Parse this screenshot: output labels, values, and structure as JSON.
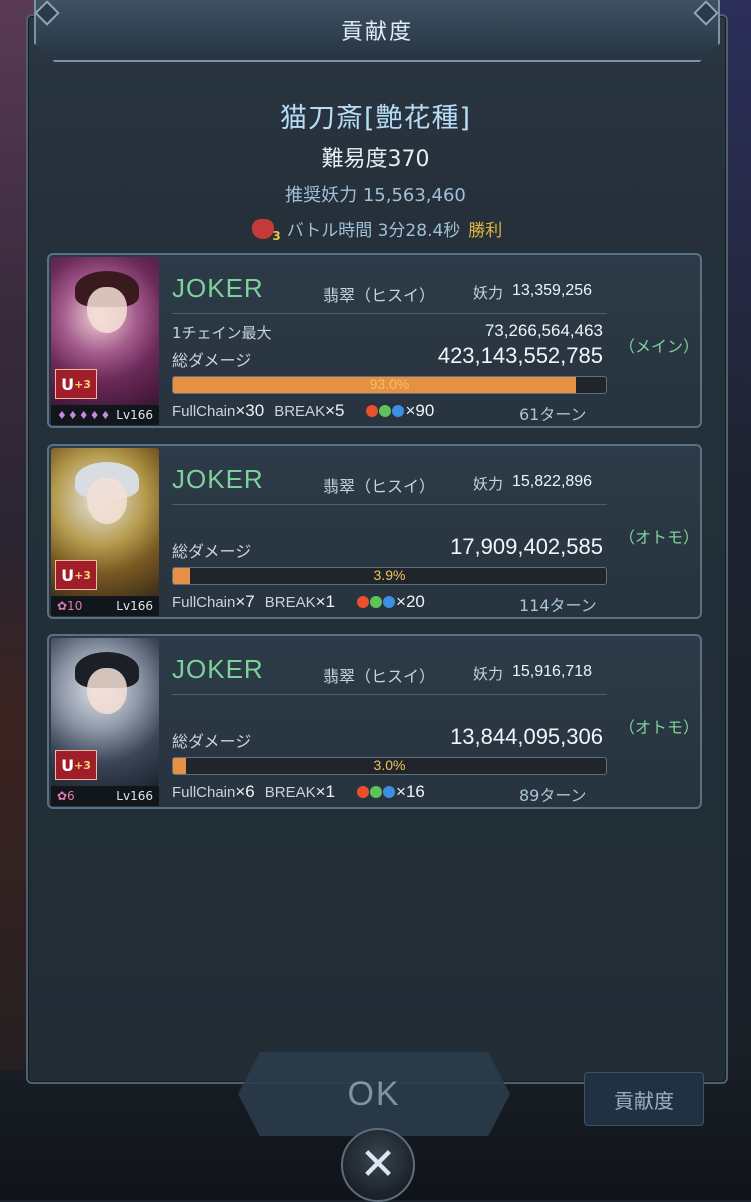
{
  "dialog": {
    "title": "貢献度"
  },
  "quest": {
    "name": "猫刀斎[艶花種]",
    "difficulty": "難易度370",
    "recommended_power": "推奨妖力 15,563,460",
    "demon_count": "3",
    "battle_time": "バトル時間 3分28.4秒",
    "result": "勝利"
  },
  "cards": [
    {
      "player": "JOKER",
      "server": "翡翠（ヒスイ）",
      "power_label": "妖力",
      "power": "13,359,256",
      "chain_label": "1チェイン最大",
      "chain_value": "73,266,564,463",
      "damage_label": "総ダメージ",
      "damage": "423,143,552,785",
      "percent_text": "93.0%",
      "percent": 93.0,
      "fullchain_label": "FullChain",
      "fullchain": "×30",
      "break_label": "BREAK",
      "break": "×5",
      "orbs": "×90",
      "turns": "61ターン",
      "role": "（メイン）",
      "rank": "U",
      "rank_plus": "+3",
      "level": "Lv166",
      "stars": "♦♦♦♦♦",
      "tama": ""
    },
    {
      "player": "JOKER",
      "server": "翡翠（ヒスイ）",
      "power_label": "妖力",
      "power": "15,822,896",
      "damage_label": "総ダメージ",
      "damage": "17,909,402,585",
      "percent_text": "3.9%",
      "percent": 3.9,
      "fullchain_label": "FullChain",
      "fullchain": "×7",
      "break_label": "BREAK",
      "break": "×1",
      "orbs": "×20",
      "turns": "114ターン",
      "role": "（オトモ）",
      "rank": "U",
      "rank_plus": "+3",
      "level": "Lv166",
      "tama": "✿10"
    },
    {
      "player": "JOKER",
      "server": "翡翠（ヒスイ）",
      "power_label": "妖力",
      "power": "15,916,718",
      "damage_label": "総ダメージ",
      "damage": "13,844,095,306",
      "percent_text": "3.0%",
      "percent": 3.0,
      "fullchain_label": "FullChain",
      "fullchain": "×6",
      "break_label": "BREAK",
      "break": "×1",
      "orbs": "×16",
      "turns": "89ターン",
      "role": "（オトモ）",
      "rank": "U",
      "rank_plus": "+3",
      "level": "Lv166",
      "tama": "✿6"
    }
  ],
  "footer": {
    "ok_label": "OK",
    "contribution_label": "貢献度",
    "close_label": "✕"
  },
  "colors": {
    "accent_green": "#7fd19b",
    "bar_fill": "#e69044",
    "percent_text": "#f3c25c",
    "win": "#e3b640"
  }
}
